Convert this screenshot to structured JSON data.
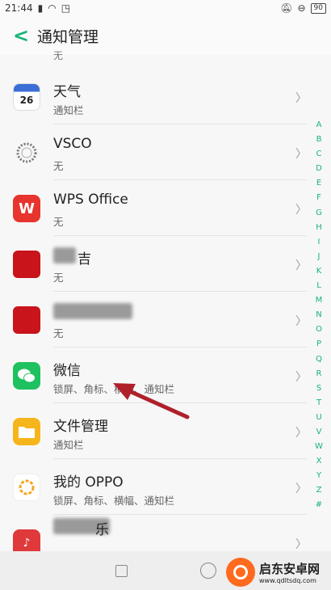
{
  "status": {
    "time": "21:44",
    "battery": "90"
  },
  "header": {
    "title": "通知管理"
  },
  "top_partial_sub": "无",
  "apps": [
    {
      "name": "天气",
      "sub": "通知栏",
      "icon": "weather-icon",
      "icon_text": "26"
    },
    {
      "name": "VSCO",
      "sub": "无",
      "icon": "vsco-icon"
    },
    {
      "name": "WPS Office",
      "sub": "无",
      "icon": "wps-icon",
      "icon_text": "W"
    },
    {
      "name": "",
      "sub": "无",
      "icon": "red-app-icon",
      "partial_text": "吉"
    },
    {
      "name": "",
      "sub": "无",
      "icon": "red-app-icon"
    },
    {
      "name": "微信",
      "sub": "锁屏、角标、横幅、通知栏",
      "icon": "wechat-icon"
    },
    {
      "name": "文件管理",
      "sub": "通知栏",
      "icon": "folder-icon"
    },
    {
      "name": "我的 OPPO",
      "sub": "锁屏、角标、横幅、通知栏",
      "icon": "oppo-icon"
    },
    {
      "name": "",
      "sub": "",
      "icon": "music-icon",
      "partial_text": "乐"
    }
  ],
  "az_index": [
    "A",
    "B",
    "C",
    "D",
    "E",
    "F",
    "G",
    "H",
    "I",
    "J",
    "K",
    "L",
    "M",
    "N",
    "O",
    "P",
    "Q",
    "R",
    "S",
    "T",
    "U",
    "V",
    "W",
    "X",
    "Y",
    "Z",
    "#"
  ],
  "watermark": {
    "title": "启东安卓网",
    "url": "www.qdltsdq.com"
  },
  "colors": {
    "accent": "#19b37a",
    "arrow": "#b0202a"
  }
}
